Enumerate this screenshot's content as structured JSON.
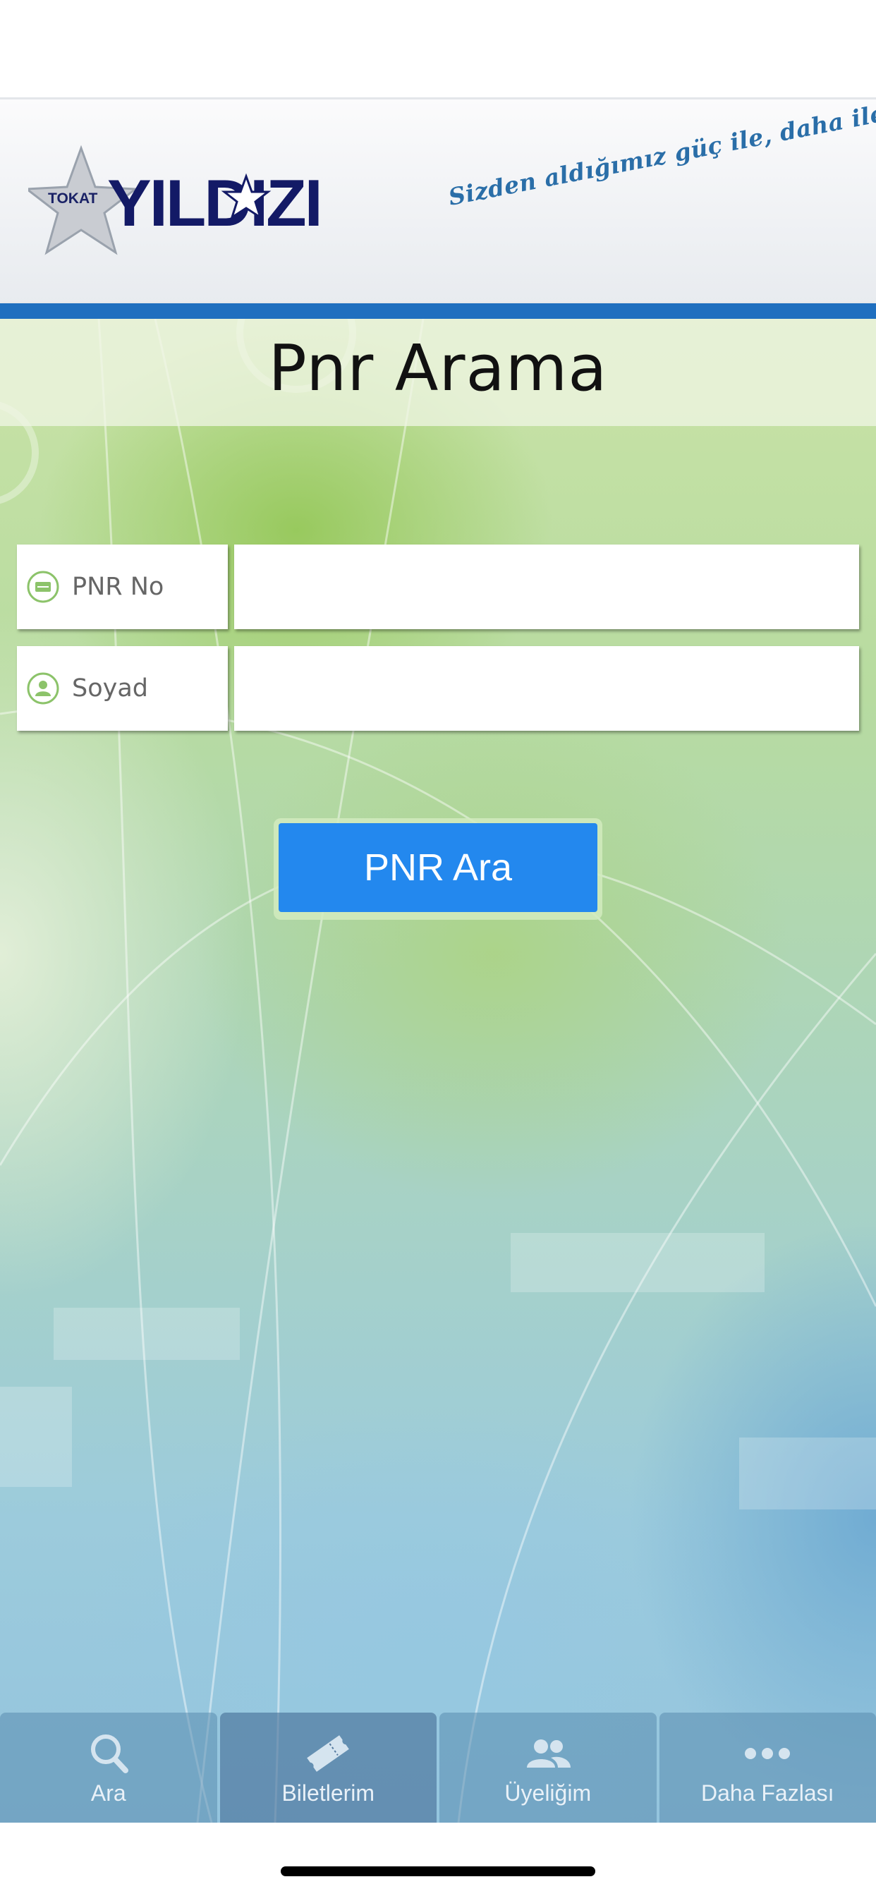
{
  "brand": {
    "logo_small": "TOKAT",
    "logo_text": "YILDIZI",
    "slogan": "Sizden aldığımız güç ile, daha ileriye...",
    "bar_color": "#1f6fbf"
  },
  "page": {
    "title": "Pnr Arama"
  },
  "form": {
    "pnr": {
      "label": "PNR No",
      "icon": "ticket-icon",
      "value": "",
      "placeholder": ""
    },
    "surname": {
      "label": "Soyad",
      "icon": "person-icon",
      "value": "",
      "placeholder": ""
    },
    "submit_label": "PNR Ara",
    "accent": "#2388ee"
  },
  "tabs": [
    {
      "label": "Ara",
      "icon": "search-icon"
    },
    {
      "label": "Biletlerim",
      "icon": "ticket-icon"
    },
    {
      "label": "Üyeliğim",
      "icon": "users-icon"
    },
    {
      "label": "Daha Fazlası",
      "icon": "more-icon"
    }
  ]
}
